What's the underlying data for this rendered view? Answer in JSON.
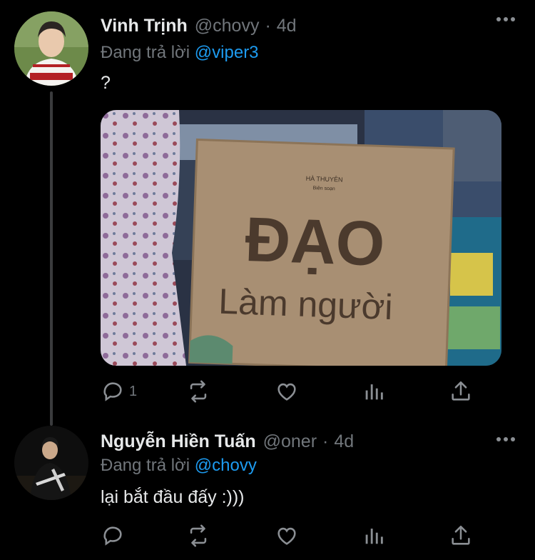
{
  "tweet1": {
    "name": "Vinh Trịnh",
    "handle": "@chovy",
    "dot": "·",
    "time": "4d",
    "replying_prefix": "Đang trả lời ",
    "replying_mention": "@viper3",
    "text": "?",
    "media": {
      "book_author": "HÀ THUYÊN",
      "book_editor": "Biên soạn",
      "book_title_1": "ĐẠO",
      "book_title_2": "Làm người"
    },
    "actions": {
      "reply_count": "1"
    }
  },
  "tweet2": {
    "name": "Nguyễn Hiền Tuấn",
    "handle": "@oner",
    "dot": "·",
    "time": "4d",
    "replying_prefix": "Đang trả lời ",
    "replying_mention": "@chovy",
    "text": "lại bắt đầu đấy :)))"
  },
  "colors": {
    "background": "#000000",
    "primary_text": "#e7e9ea",
    "secondary_text": "#71767b",
    "accent": "#1d9bf0"
  },
  "icons": [
    "more-icon",
    "reply-icon",
    "retweet-icon",
    "like-icon",
    "analytics-icon",
    "share-icon"
  ]
}
